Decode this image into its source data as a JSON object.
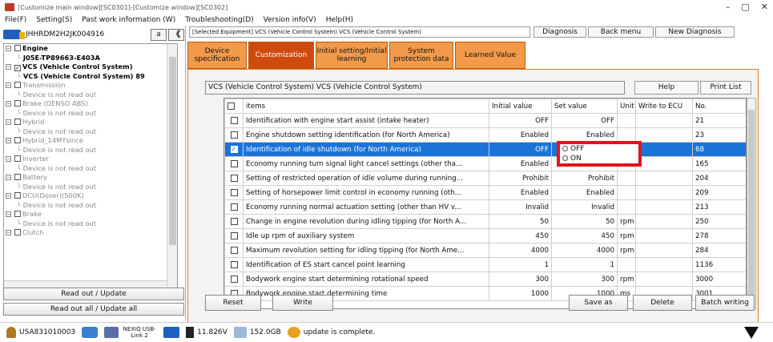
{
  "window": {
    "title": "[Customize main window][SC0301]-[Customize window][SC0302]"
  },
  "menu": [
    "File(F)",
    "Setting(S)",
    "Past work information (W)",
    "Troubleshooting(D)",
    "Version info(V)",
    "Help(H)"
  ],
  "vehicle": {
    "vin": "JHHRDM2H2JK004916",
    "a_label": "a",
    "collapse_label": "《"
  },
  "tree": [
    {
      "label": "Engine",
      "cls": "l0 b",
      "exp": "⊟",
      "cb": ""
    },
    {
      "label": "J05E-TP89663-E403A",
      "cls": "l1 b",
      "exp": "",
      "cb": ""
    },
    {
      "label": "VCS (Vehicle Control System)",
      "cls": "l0 b",
      "exp": "⊟",
      "cb": "✓"
    },
    {
      "label": "VCS (Vehicle Control System) 89",
      "cls": "l1 sel",
      "exp": "",
      "cb": ""
    },
    {
      "label": "Transmission",
      "cls": "l0 dim",
      "exp": "⊟",
      "cb": ""
    },
    {
      "label": "Device is not read out",
      "cls": "l1",
      "exp": "",
      "cb": ""
    },
    {
      "label": "Brake (DENSO ABS)",
      "cls": "l0 dim",
      "exp": "⊟",
      "cb": ""
    },
    {
      "label": "Device is not read out",
      "cls": "l1",
      "exp": "",
      "cb": ""
    },
    {
      "label": "Hybrid",
      "cls": "l0 dim",
      "exp": "⊟",
      "cb": ""
    },
    {
      "label": "Device is not read out",
      "cls": "l1",
      "exp": "",
      "cb": ""
    },
    {
      "label": "Hybrid_14MYsince",
      "cls": "l0 dim",
      "exp": "⊟",
      "cb": ""
    },
    {
      "label": "Device is not read out",
      "cls": "l1",
      "exp": "",
      "cb": ""
    },
    {
      "label": "Inverter",
      "cls": "l0 dim",
      "exp": "⊟",
      "cb": ""
    },
    {
      "label": "Device is not read out",
      "cls": "l1",
      "exp": "",
      "cb": ""
    },
    {
      "label": "Battery",
      "cls": "l0 dim",
      "exp": "⊟",
      "cb": ""
    },
    {
      "label": "Device is not read out",
      "cls": "l1",
      "exp": "",
      "cb": ""
    },
    {
      "label": "DCU(Doser)(500K)",
      "cls": "l0 dim",
      "exp": "⊟",
      "cb": ""
    },
    {
      "label": "Device is not read out",
      "cls": "l1",
      "exp": "",
      "cb": ""
    },
    {
      "label": "Brake",
      "cls": "l0 dim",
      "exp": "⊟",
      "cb": ""
    },
    {
      "label": "Device is not read out",
      "cls": "l1",
      "exp": "",
      "cb": ""
    },
    {
      "label": "Clutch",
      "cls": "l0 dim",
      "exp": "⊟",
      "cb": ""
    }
  ],
  "left_buttons": {
    "read_update": "Read out / Update",
    "read_all": "Read out all / Update all"
  },
  "breadcrumb": "[Selected Equipment] VCS (Vehicle Control System) VCS (Vehicle Control System)",
  "top_buttons": {
    "diagnosis": "Diagnosis",
    "back": "Back menu",
    "new_diag": "New Diagnosis"
  },
  "tabs": [
    "Device specification",
    "Customization",
    "Initial setting/Initial learning",
    "System protection data",
    "Learned Value"
  ],
  "system_label": "VCS (Vehicle Control System) VCS (Vehicle Control System)",
  "panel_buttons": {
    "help": "Help",
    "print": "Print List"
  },
  "columns": {
    "items": "items",
    "initial": "Initial value",
    "set": "Set value",
    "unit": "Unit",
    "write": "Write to ECU",
    "no": "No."
  },
  "rows": [
    {
      "chk": "",
      "item": "Identification with engine start assist (intake heater)",
      "initial": "OFF",
      "set": "OFF",
      "unit": "",
      "write": "",
      "no": "21"
    },
    {
      "chk": "",
      "item": "Engine shutdown setting identification (for North America)",
      "initial": "Enabled",
      "set": "Enabled",
      "unit": "",
      "write": "",
      "no": "23"
    },
    {
      "chk": "✓",
      "item": "Identification of idle shutdown (for North America)",
      "initial": "OFF",
      "set": "",
      "unit": "",
      "write": "",
      "no": "68",
      "selected": true
    },
    {
      "chk": "",
      "item": "Economy running  turn signal light cancel settings (other tha...",
      "initial": "Enabled",
      "set": "",
      "unit": "",
      "write": "",
      "no": "165"
    },
    {
      "chk": "",
      "item": "Setting of restricted operation of idle volume during running...",
      "initial": "Prohibit",
      "set": "Prohibit",
      "unit": "",
      "write": "",
      "no": "204"
    },
    {
      "chk": "",
      "item": "Setting of horsepower limit control in economy running (oth...",
      "initial": "Enabled",
      "set": "Enabled",
      "unit": "",
      "write": "",
      "no": "209"
    },
    {
      "chk": "",
      "item": "Economy running normal actuation setting (other than HV v...",
      "initial": "Invalid",
      "set": "Invalid",
      "unit": "",
      "write": "",
      "no": "213"
    },
    {
      "chk": "",
      "item": "Change in engine revolution during idling tipping (for North A...",
      "initial": "50",
      "set": "50",
      "unit": "rpm",
      "write": "",
      "no": "250"
    },
    {
      "chk": "",
      "item": "Idle up rpm of auxiliary system",
      "initial": "450",
      "set": "450",
      "unit": "rpm",
      "write": "",
      "no": "278"
    },
    {
      "chk": "",
      "item": "Maximum revolution setting for idling tipping (for North Ame...",
      "initial": "4000",
      "set": "4000",
      "unit": "rpm",
      "write": "",
      "no": "284"
    },
    {
      "chk": "",
      "item": "Identification of ES start cancel  point learning",
      "initial": "1",
      "set": "1",
      "unit": "",
      "write": "",
      "no": "1136"
    },
    {
      "chk": "",
      "item": "Bodywork engine start determining rotational speed",
      "initial": "300",
      "set": "300",
      "unit": "rpm",
      "write": "",
      "no": "3000"
    },
    {
      "chk": "",
      "item": "Bodywork engine start determining time",
      "initial": "1000",
      "set": "1000",
      "unit": "ms",
      "write": "",
      "no": "3001"
    }
  ],
  "dropdown": {
    "opt_off": "OFF",
    "opt_on": "ON"
  },
  "bottom_buttons": {
    "reset": "Reset",
    "write": "Write",
    "save_as": "Save as",
    "delete": "Delete",
    "batch": "Batch writing"
  },
  "status": {
    "port": "USA831010003",
    "device": "NEXIQ USB-Link 2",
    "voltage": "11.826V",
    "disk": "152.0GB",
    "message": "update is complete."
  },
  "colors": {
    "tab": "#f39a4a",
    "tab_active": "#d04a10",
    "selection": "#1a73d8",
    "highlight_box": "#e0141c"
  }
}
